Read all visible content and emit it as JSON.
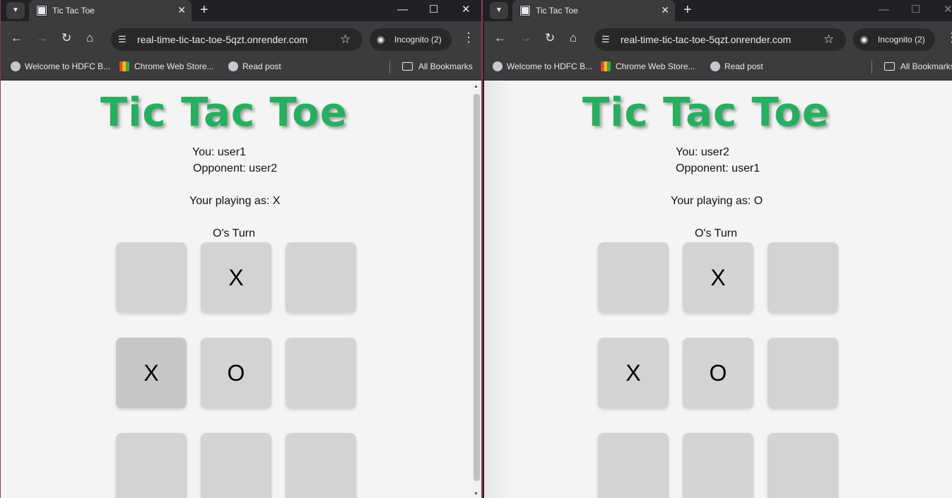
{
  "windows": [
    {
      "tab_title": "Tic Tac Toe",
      "url": "real-time-tic-tac-toe-5qzt.onrender.com",
      "incognito_label": "Incognito (2)",
      "bookmarks": [
        "Welcome to HDFC B...",
        "Chrome Web Store...",
        "Read post"
      ],
      "all_bookmarks": "All Bookmarks",
      "game": {
        "title": "Tic Tac Toe",
        "you": "You: user1",
        "opponent": "Opponent: user2",
        "playing_as": "Your playing as: X",
        "turn": "O's Turn",
        "board": [
          "",
          "X",
          "",
          "X",
          "O",
          "",
          "",
          "",
          ""
        ]
      }
    },
    {
      "tab_title": "Tic Tac Toe",
      "url": "real-time-tic-tac-toe-5qzt.onrender.com",
      "incognito_label": "Incognito (2)",
      "bookmarks": [
        "Welcome to HDFC B...",
        "Chrome Web Store...",
        "Read post"
      ],
      "all_bookmarks": "All Bookmarks",
      "game": {
        "title": "Tic Tac Toe",
        "you": "You: user2",
        "opponent": "Opponent: user1",
        "playing_as": "Your playing as: O",
        "turn": "O's Turn",
        "board": [
          "",
          "X",
          "",
          "X",
          "O",
          "",
          "",
          "",
          ""
        ]
      }
    }
  ],
  "colors": {
    "title_green": "#27ae60",
    "cell_bg": "#d3d3d3",
    "chrome_dark": "#3c3c3c",
    "active_border": "#a0325a"
  },
  "icons": [
    "tab-list-icon",
    "favicon-icon",
    "close-icon",
    "plus-icon",
    "minimize-icon",
    "maximize-icon",
    "back-icon",
    "forward-icon",
    "reload-icon",
    "home-icon",
    "site-info-icon",
    "star-icon",
    "incognito-icon",
    "menu-icon",
    "globe-icon",
    "folder-icon"
  ]
}
